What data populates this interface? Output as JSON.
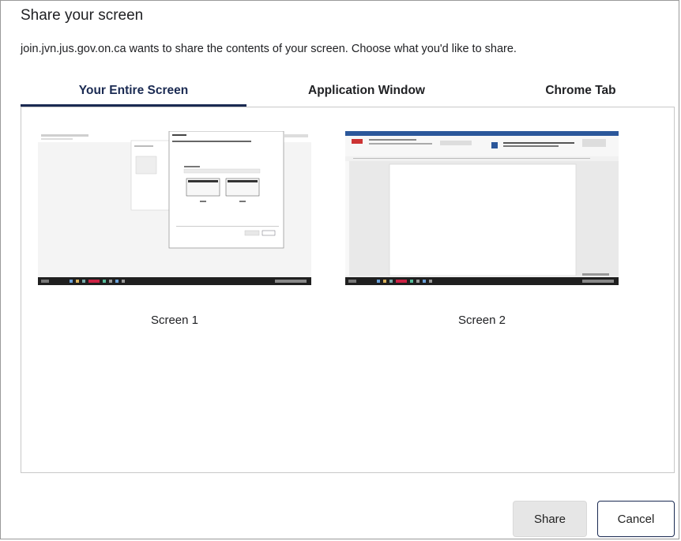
{
  "dialog": {
    "title": "Share your screen",
    "subtitle": "join.jvn.jus.gov.on.ca wants to share the contents of your screen. Choose what you'd like to share."
  },
  "tabs": [
    {
      "label": "Your Entire Screen",
      "active": true
    },
    {
      "label": "Application Window",
      "active": false
    },
    {
      "label": "Chrome Tab",
      "active": false
    }
  ],
  "sources": [
    {
      "label": "Screen 1"
    },
    {
      "label": "Screen 2"
    }
  ],
  "buttons": {
    "share": "Share",
    "cancel": "Cancel"
  },
  "colors": {
    "accent": "#1a2a52",
    "share_bg": "#e6e6e6"
  }
}
